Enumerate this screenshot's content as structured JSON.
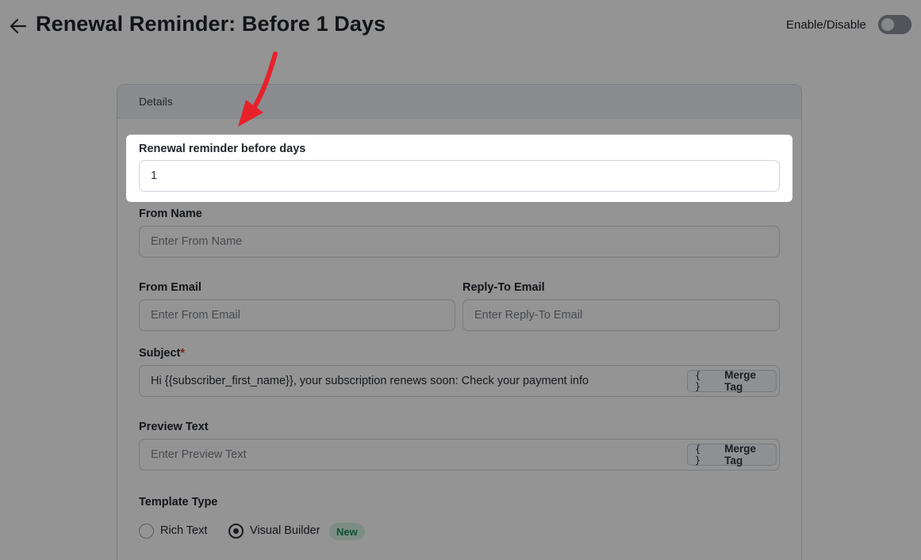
{
  "header": {
    "title": "Renewal Reminder: Before 1 Days",
    "toggle_label": "Enable/Disable",
    "toggle_on": false
  },
  "card": {
    "section_title": "Details",
    "reminder_days": {
      "label": "Renewal reminder before days",
      "value": "1"
    },
    "from_name": {
      "label": "From Name",
      "placeholder": "Enter From Name",
      "value": ""
    },
    "from_email": {
      "label": "From Email",
      "placeholder": "Enter From Email",
      "value": ""
    },
    "reply_to": {
      "label": "Reply-To Email",
      "placeholder": "Enter Reply-To Email",
      "value": ""
    },
    "subject": {
      "label": "Subject",
      "required_mark": "*",
      "value": "Hi {{subscriber_first_name}}, your subscription renews soon: Check your payment info",
      "merge_braces": "{ }",
      "merge_label": "Merge Tag"
    },
    "preview_text": {
      "label": "Preview Text",
      "placeholder": "Enter Preview Text",
      "value": "",
      "merge_braces": "{ }",
      "merge_label": "Merge Tag"
    },
    "template_type": {
      "label": "Template Type",
      "options": [
        {
          "label": "Rich Text",
          "selected": false
        },
        {
          "label": "Visual Builder",
          "selected": true,
          "badge": "New"
        }
      ]
    }
  },
  "colors": {
    "annotation_arrow": "#e8202a",
    "badge_bg": "#d7f3e6",
    "badge_text": "#1b8b5f"
  }
}
